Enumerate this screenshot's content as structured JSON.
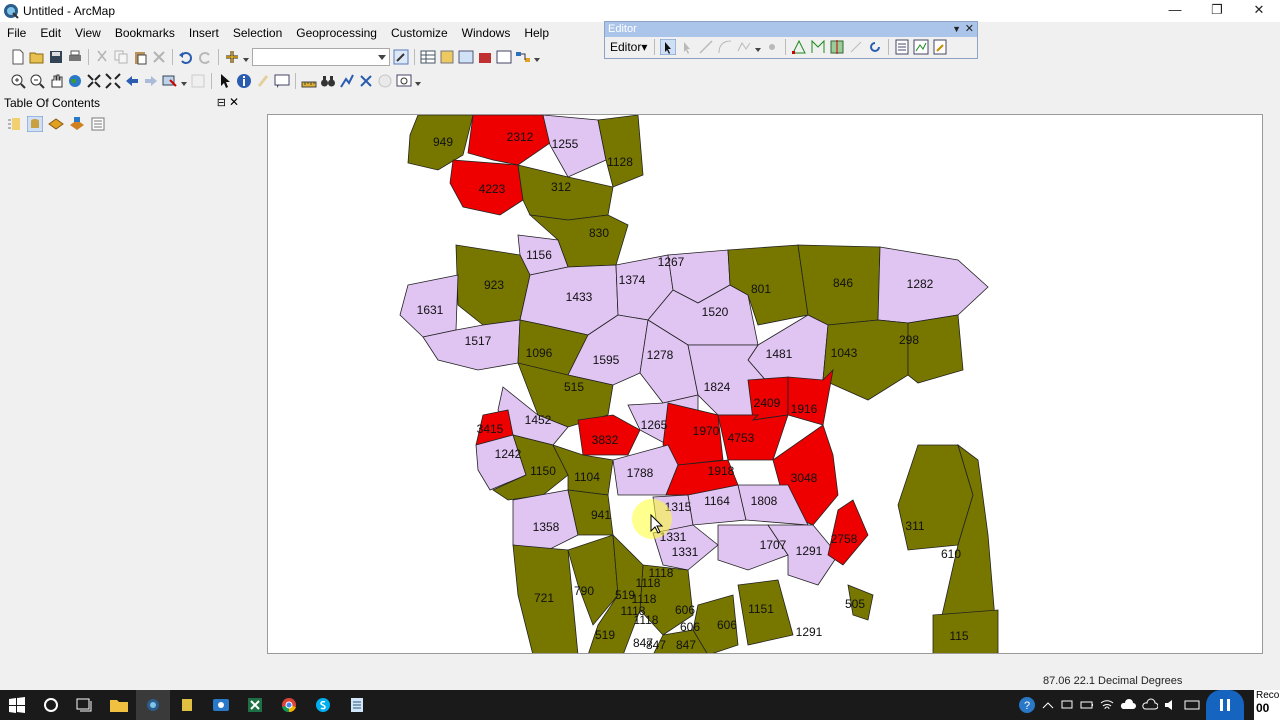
{
  "window": {
    "title": "Untitled - ArcMap",
    "minimize": "—",
    "restore": "❐",
    "close": "✕"
  },
  "menu": [
    "File",
    "Edit",
    "View",
    "Bookmarks",
    "Insert",
    "Selection",
    "Geoprocessing",
    "Customize",
    "Windows",
    "Help"
  ],
  "editor": {
    "title": "Editor",
    "menu_label": "Editor",
    "close": "✕"
  },
  "toc": {
    "title": "Table Of Contents",
    "pin": "⊟",
    "close": "✕"
  },
  "status": {
    "coords": "87.06  22.1 Decimal Degrees"
  },
  "recording": {
    "label": "Reco",
    "time": "00"
  },
  "colors": {
    "red": "#ee0000",
    "olive": "#777700",
    "lavender": "#e0c4f2",
    "outline": "#222222"
  },
  "map": {
    "districts": [
      {
        "label": "949",
        "fill": "olive"
      },
      {
        "label": "2312",
        "fill": "red"
      },
      {
        "label": "1255",
        "fill": "lavender"
      },
      {
        "label": "1128",
        "fill": "olive"
      },
      {
        "label": "4223",
        "fill": "red"
      },
      {
        "label": "312",
        "fill": "olive"
      },
      {
        "label": "830",
        "fill": "olive"
      },
      {
        "label": "1156",
        "fill": "lavender"
      },
      {
        "label": "923",
        "fill": "olive"
      },
      {
        "label": "1433",
        "fill": "lavender"
      },
      {
        "label": "1374",
        "fill": "lavender"
      },
      {
        "label": "1267",
        "fill": "lavender"
      },
      {
        "label": "1520",
        "fill": "lavender"
      },
      {
        "label": "801",
        "fill": "olive"
      },
      {
        "label": "846",
        "fill": "olive"
      },
      {
        "label": "1282",
        "fill": "lavender"
      },
      {
        "label": "1631",
        "fill": "lavender"
      },
      {
        "label": "1517",
        "fill": "lavender"
      },
      {
        "label": "1096",
        "fill": "olive"
      },
      {
        "label": "1595",
        "fill": "lavender"
      },
      {
        "label": "1278",
        "fill": "lavender"
      },
      {
        "label": "1481",
        "fill": "lavender"
      },
      {
        "label": "1043",
        "fill": "olive"
      },
      {
        "label": "298",
        "fill": "olive"
      },
      {
        "label": "515",
        "fill": "olive"
      },
      {
        "label": "1824",
        "fill": "lavender"
      },
      {
        "label": "2409",
        "fill": "red"
      },
      {
        "label": "1916",
        "fill": "red"
      },
      {
        "label": "1452",
        "fill": "lavender"
      },
      {
        "label": "3415",
        "fill": "red"
      },
      {
        "label": "3832",
        "fill": "red"
      },
      {
        "label": "1265",
        "fill": "lavender"
      },
      {
        "label": "1970",
        "fill": "red"
      },
      {
        "label": "4753",
        "fill": "red"
      },
      {
        "label": "1242",
        "fill": "lavender"
      },
      {
        "label": "1150",
        "fill": "olive"
      },
      {
        "label": "1104",
        "fill": "olive"
      },
      {
        "label": "1788",
        "fill": "lavender"
      },
      {
        "label": "1918",
        "fill": "red"
      },
      {
        "label": "3048",
        "fill": "red"
      },
      {
        "label": "1358",
        "fill": "lavender"
      },
      {
        "label": "941",
        "fill": "olive"
      },
      {
        "label": "1315",
        "fill": "lavender"
      },
      {
        "label": "1164",
        "fill": "lavender"
      },
      {
        "label": "1808",
        "fill": "lavender"
      },
      {
        "label": "1331",
        "fill": "lavender"
      },
      {
        "label": "1707",
        "fill": "lavender"
      },
      {
        "label": "1291",
        "fill": "lavender"
      },
      {
        "label": "2758",
        "fill": "red"
      },
      {
        "label": "311",
        "fill": "olive"
      },
      {
        "label": "610",
        "fill": "olive"
      },
      {
        "label": "1118",
        "fill": "olive"
      },
      {
        "label": "721",
        "fill": "olive"
      },
      {
        "label": "790",
        "fill": "olive"
      },
      {
        "label": "519",
        "fill": "olive"
      },
      {
        "label": "1151",
        "fill": "olive"
      },
      {
        "label": "606",
        "fill": "olive"
      },
      {
        "label": "505",
        "fill": "olive"
      },
      {
        "label": "847",
        "fill": "olive"
      },
      {
        "label": "115",
        "fill": "olive"
      }
    ]
  }
}
